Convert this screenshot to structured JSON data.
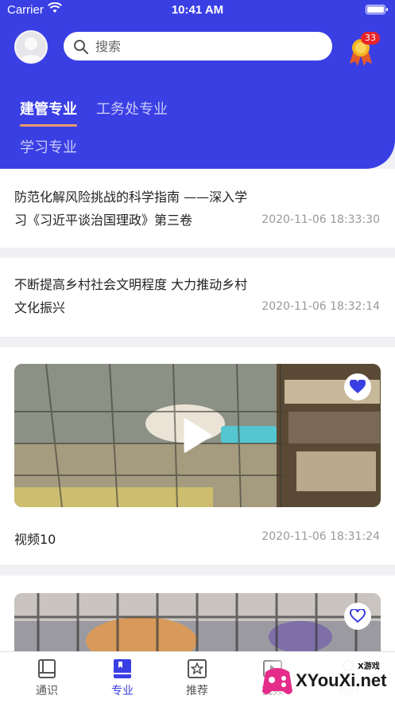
{
  "status_bar": {
    "carrier": "Carrier",
    "time": "10:41 AM"
  },
  "header": {
    "search_placeholder": "搜索",
    "medal_badge": "33",
    "tabs": [
      {
        "label": "建管专业",
        "active": true
      },
      {
        "label": "工务处专业",
        "active": false
      },
      {
        "label": "学习专业",
        "active": false
      }
    ]
  },
  "feed": {
    "news": [
      {
        "title": "防范化解风险挑战的科学指南 ——深入学习《习近平谈治国理政》第三卷",
        "date": "2020-11-06 18:33:30"
      },
      {
        "title": "不断提高乡村社会文明程度 大力推动乡村文化振兴",
        "date": "2020-11-06 18:32:14"
      }
    ],
    "videos": [
      {
        "title": "视频10",
        "date": "2020-11-06 18:31:24",
        "favorited": true
      },
      {
        "title": "",
        "date": "",
        "favorited": false
      }
    ]
  },
  "tabbar": {
    "items": [
      {
        "label": "通识",
        "icon": "book-icon",
        "active": false
      },
      {
        "label": "专业",
        "icon": "bookmark-book-icon",
        "active": true
      },
      {
        "label": "推荐",
        "icon": "star-icon",
        "active": false
      },
      {
        "label": "视频",
        "icon": "video-icon",
        "active": false
      },
      {
        "label": "我的",
        "icon": "user-icon",
        "active": false
      }
    ]
  },
  "watermark": {
    "small": "X游戏",
    "big": "XYouXi.net"
  },
  "colors": {
    "primary": "#3a3fe4",
    "tab_underline": "#ea9a6a",
    "badge": "#e8242a"
  }
}
